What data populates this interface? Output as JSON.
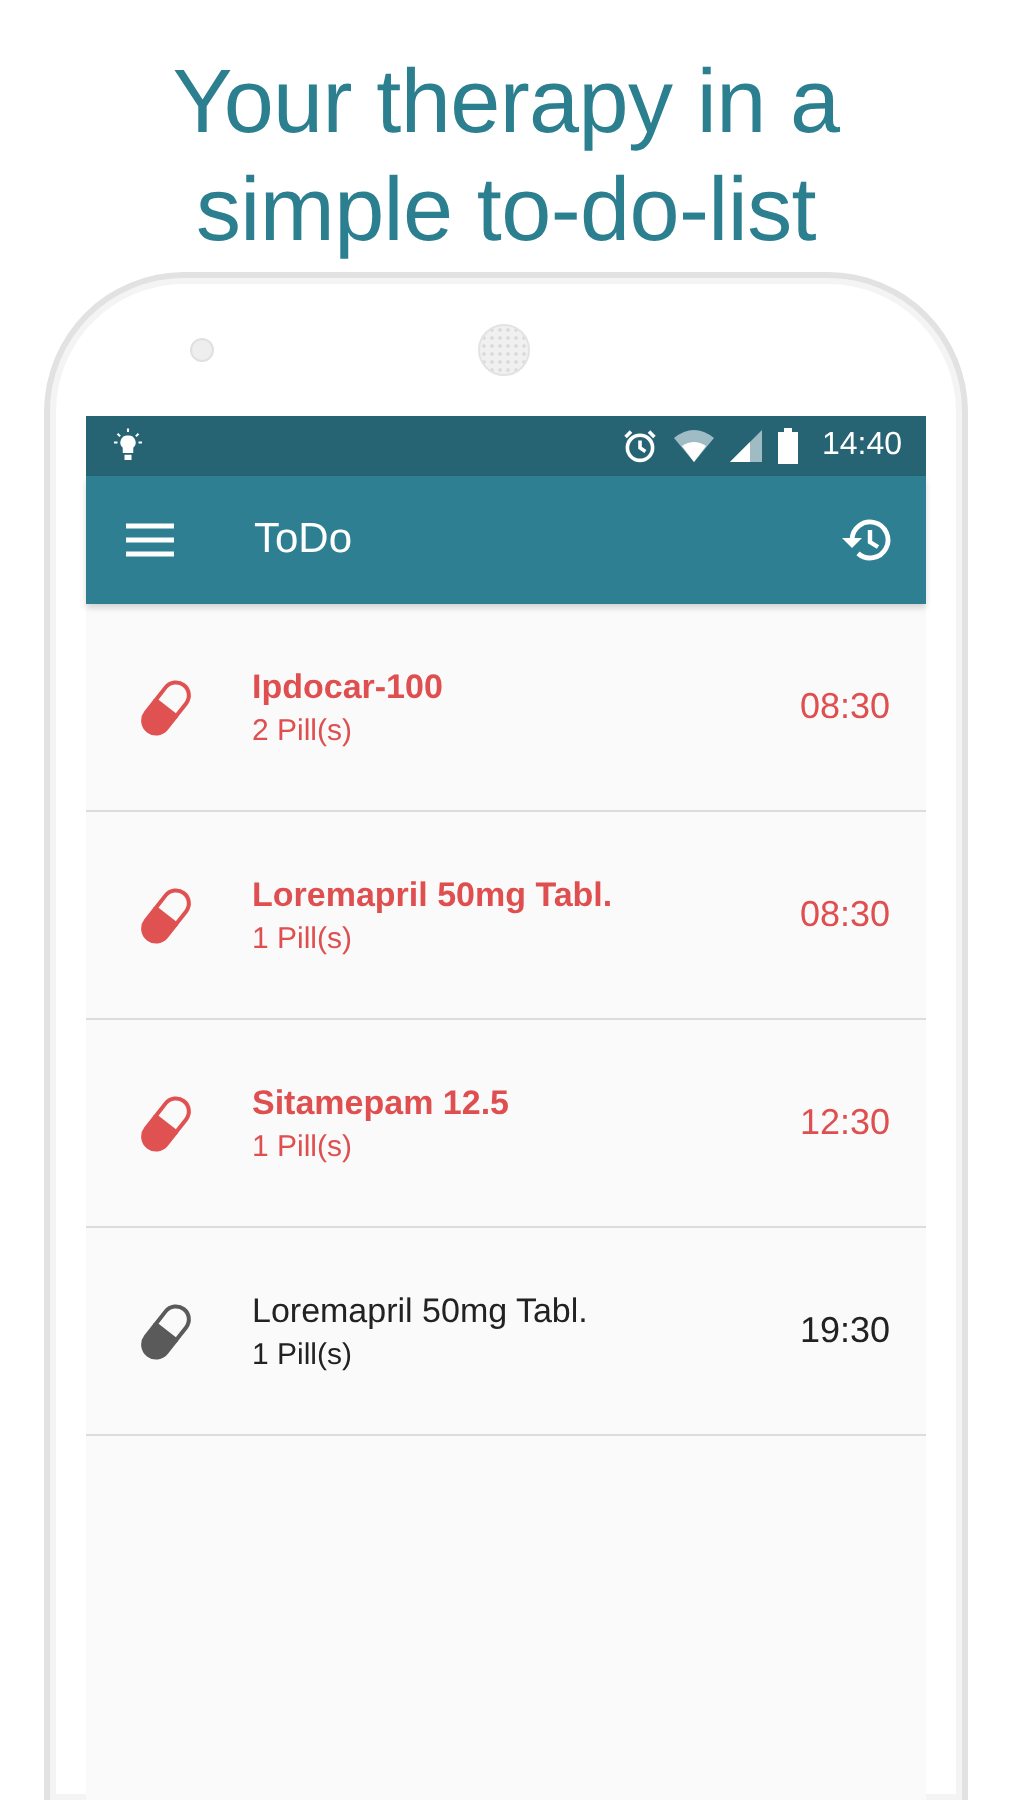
{
  "headline": [
    "Your therapy in a",
    "simple to-do-list"
  ],
  "status_bar": {
    "time": "14:40"
  },
  "app_bar": {
    "title": "ToDo"
  },
  "items": [
    {
      "name": "Ipdocar-100",
      "dose": "2 Pill(s)",
      "time": "08:30",
      "due": true
    },
    {
      "name": "Loremapril 50mg Tabl.",
      "dose": "1 Pill(s)",
      "time": "08:30",
      "due": true
    },
    {
      "name": "Sitamepam 12.5",
      "dose": "1 Pill(s)",
      "time": "12:30",
      "due": true
    },
    {
      "name": "Loremapril 50mg Tabl.",
      "dose": "1 Pill(s)",
      "time": "19:30",
      "due": false
    }
  ]
}
